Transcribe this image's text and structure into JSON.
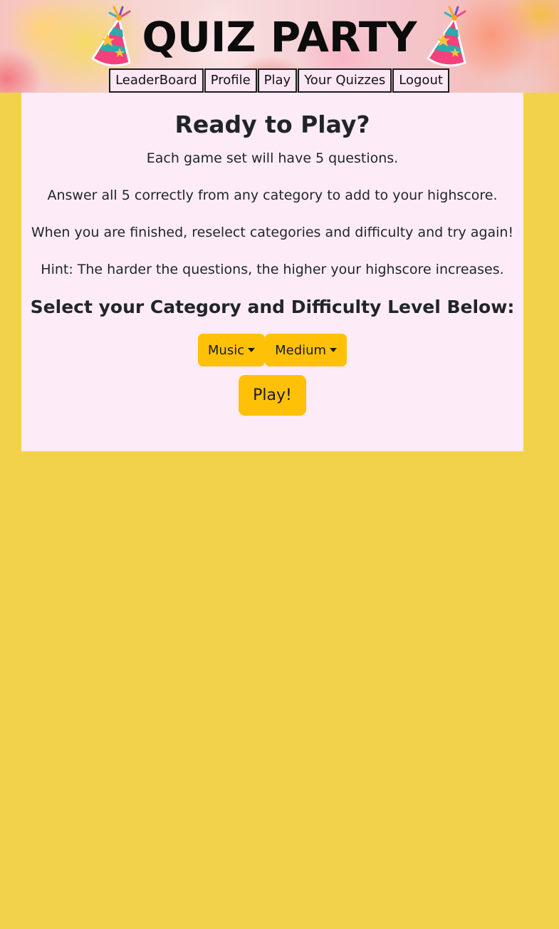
{
  "header": {
    "title": "QUIZ PARTY",
    "nav": [
      {
        "label": "LeaderBoard"
      },
      {
        "label": "Profile"
      },
      {
        "label": "Play"
      },
      {
        "label": "Your Quizzes"
      },
      {
        "label": "Logout"
      }
    ],
    "icons": [
      "party-hat-icon",
      "party-hat-icon"
    ]
  },
  "main": {
    "heading": "Ready to Play?",
    "paragraphs": [
      "Each game set will have 5 questions.",
      "Answer all 5 correctly from any category to add to your highscore.",
      "When you are finished, reselect categories and difficulty and try again!",
      "Hint: The harder the questions, the higher your highscore increases."
    ],
    "subheading": "Select your Category and Difficulty Level Below:",
    "category_selected": "Music",
    "difficulty_selected": "Medium",
    "play_label": "Play!"
  },
  "colors": {
    "page_background": "#f2d14b",
    "card_background": "#fdecf8",
    "button": "#ffc107",
    "nav_background": "#fde7f5"
  }
}
